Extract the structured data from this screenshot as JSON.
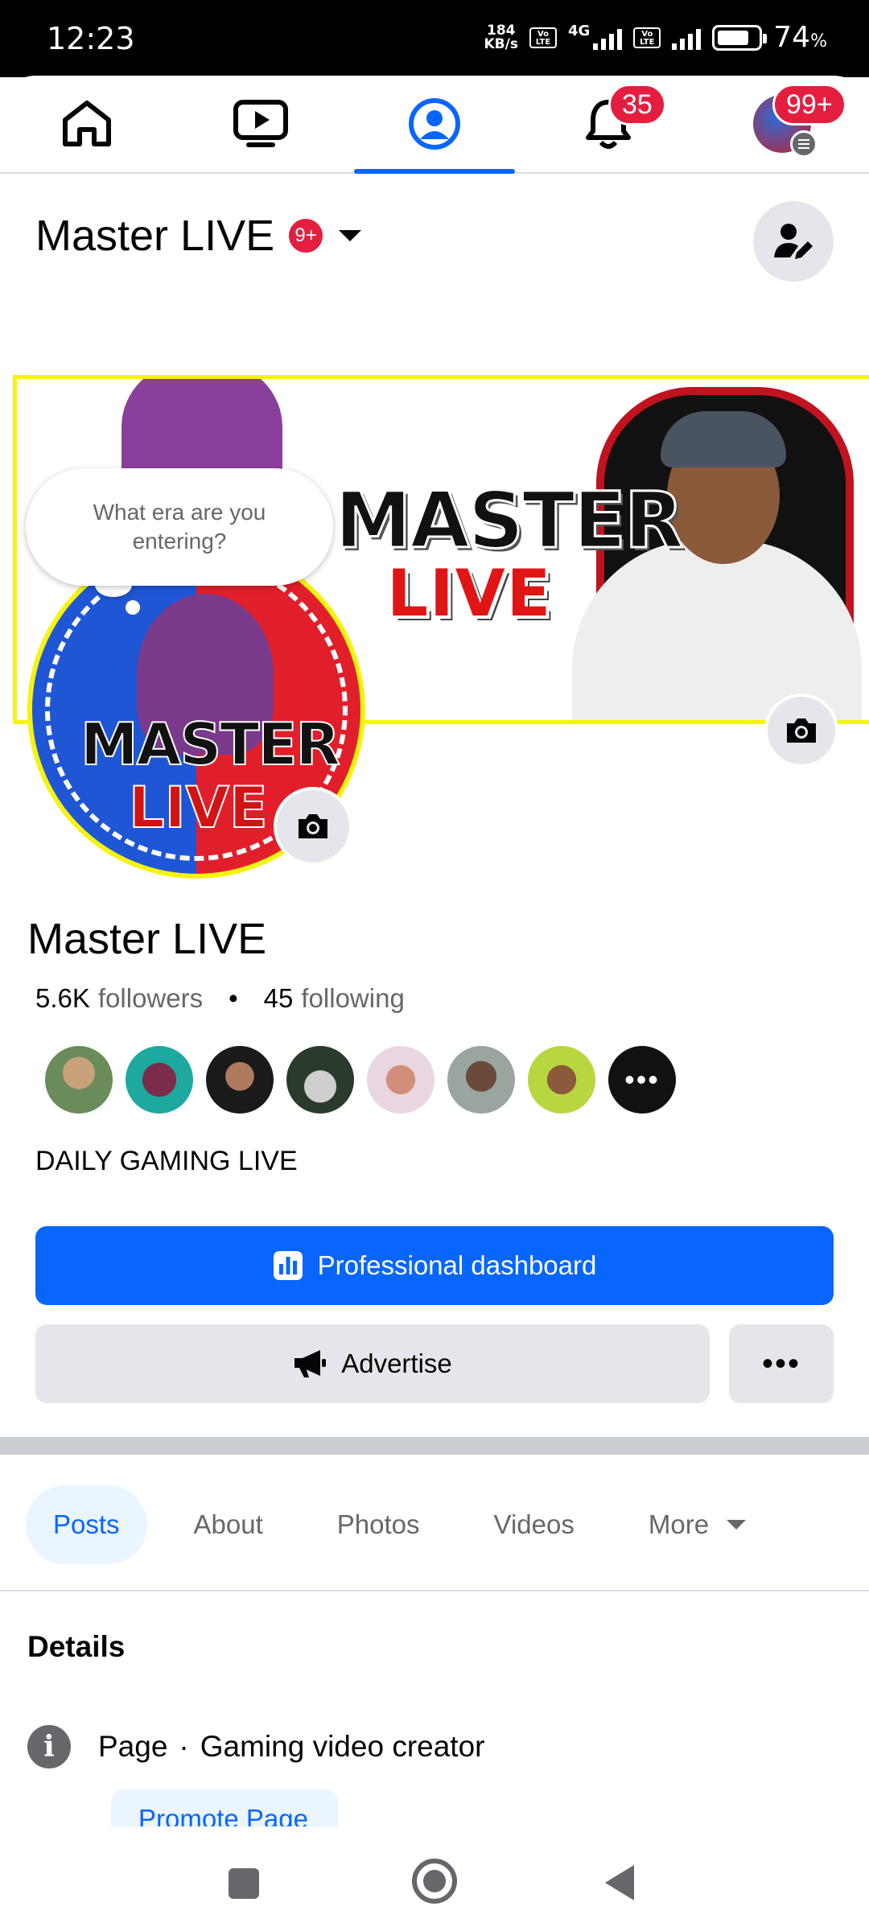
{
  "status_bar": {
    "time": "12:23",
    "net_speed_value": "184",
    "net_speed_unit": "KB/s",
    "network_type": "4G",
    "volte_label": "Vo LTE",
    "battery_percent": "74",
    "battery_percent_sign": "%"
  },
  "top_nav": {
    "notifications_badge": "35",
    "menu_badge": "99+"
  },
  "header": {
    "page_name": "Master LIVE",
    "badge": "9+"
  },
  "cover": {
    "title_line1": "MASTER",
    "title_line2": "LIVE"
  },
  "profile_picture": {
    "text_line1": "MASTER",
    "text_line2": "LIVE"
  },
  "thought_bubble": "What era are you entering?",
  "profile": {
    "name": "Master LIVE",
    "followers_count": "5.6K",
    "followers_label": "followers",
    "following_count": "45",
    "following_label": "following",
    "bio": "DAILY GAMING LIVE",
    "friends_more_label": "•••"
  },
  "actions": {
    "dashboard_label": "Professional dashboard",
    "advertise_label": "Advertise",
    "more_label": "•••"
  },
  "tabs": [
    "Posts",
    "About",
    "Photos",
    "Videos",
    "More"
  ],
  "details": {
    "title": "Details",
    "page_label": "Page",
    "separator": "·",
    "category": "Gaming video creator",
    "promote_label": "Promote Page"
  },
  "colors": {
    "accent": "#0866ff",
    "badge_red": "#e41e3f",
    "cover_border": "#f4f410"
  }
}
